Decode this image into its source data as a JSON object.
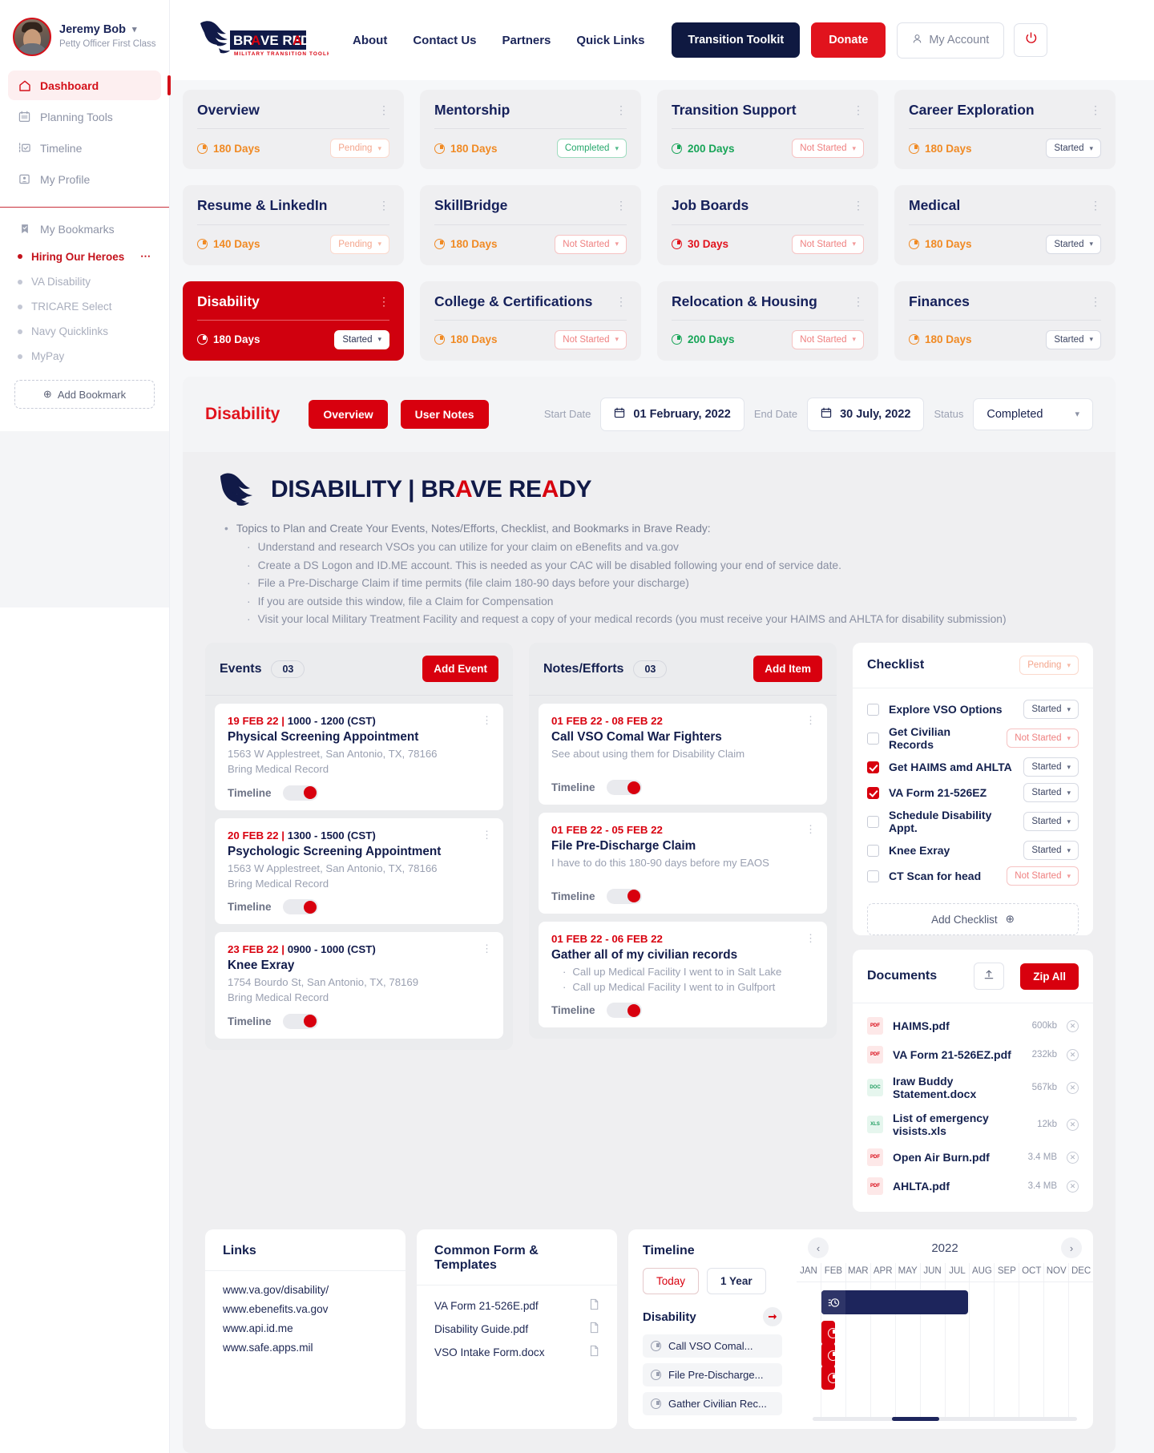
{
  "sidebar": {
    "profile": {
      "name": "Jeremy Bob",
      "rank": "Petty Officer First Class"
    },
    "nav": [
      {
        "label": "Dashboard",
        "icon": "home-icon",
        "active": true
      },
      {
        "label": "Planning Tools",
        "icon": "calendar-icon",
        "active": false
      },
      {
        "label": "Timeline",
        "icon": "timeline-icon",
        "active": false
      },
      {
        "label": "My Profile",
        "icon": "profile-icon",
        "active": false
      }
    ],
    "bookmarks_header": "My Bookmarks",
    "bookmarks": [
      {
        "label": "Hiring Our Heroes",
        "active": true
      },
      {
        "label": "VA Disability",
        "active": false
      },
      {
        "label": "TRICARE Select",
        "active": false
      },
      {
        "label": "Navy Quicklinks",
        "active": false
      },
      {
        "label": "MyPay",
        "active": false
      }
    ],
    "add_bookmark": "Add Bookmark"
  },
  "topbar": {
    "brand": {
      "line1": "BRAVE READY",
      "line2": "MILITARY TRANSITION TOOLKIT"
    },
    "links": [
      "About",
      "Contact Us",
      "Partners",
      "Quick Links"
    ],
    "transition_toolkit": "Transition Toolkit",
    "donate": "Donate",
    "my_account": "My Account",
    "logout_icon": "power-icon"
  },
  "cards": [
    {
      "title": "Overview",
      "days": "180 Days",
      "days_color": "orange",
      "status": "Pending",
      "status_style": "pending",
      "selected": false
    },
    {
      "title": "Mentorship",
      "days": "180 Days",
      "days_color": "orange",
      "status": "Completed",
      "status_style": "completed",
      "selected": false
    },
    {
      "title": "Transition Support",
      "days": "200 Days",
      "days_color": "green",
      "status": "Not Started",
      "status_style": "notstarted",
      "selected": false
    },
    {
      "title": "Career Exploration",
      "days": "180 Days",
      "days_color": "orange",
      "status": "Started",
      "status_style": "started",
      "selected": false
    },
    {
      "title": "Resume & LinkedIn",
      "days": "140 Days",
      "days_color": "orange",
      "status": "Pending",
      "status_style": "pending",
      "selected": false
    },
    {
      "title": "SkillBridge",
      "days": "180 Days",
      "days_color": "orange",
      "status": "Not Started",
      "status_style": "notstarted",
      "selected": false
    },
    {
      "title": "Job Boards",
      "days": "30 Days",
      "days_color": "red",
      "status": "Not Started",
      "status_style": "notstarted",
      "selected": false
    },
    {
      "title": "Medical",
      "days": "180 Days",
      "days_color": "orange",
      "status": "Started",
      "status_style": "started",
      "selected": false
    },
    {
      "title": "Disability",
      "days": "180 Days",
      "days_color": "orange",
      "status": "Started",
      "status_style": "started",
      "selected": true
    },
    {
      "title": "College & Certifications",
      "days": "180 Days",
      "days_color": "orange",
      "status": "Not Started",
      "status_style": "notstarted",
      "selected": false
    },
    {
      "title": "Relocation & Housing",
      "days": "200 Days",
      "days_color": "green",
      "status": "Not Started",
      "status_style": "notstarted",
      "selected": false
    },
    {
      "title": "Finances",
      "days": "180 Days",
      "days_color": "orange",
      "status": "Started",
      "status_style": "started",
      "selected": false
    }
  ],
  "detail": {
    "title": "Disability",
    "tab_overview": "Overview",
    "tab_user_notes": "User Notes",
    "start_date_label": "Start Date",
    "start_date": "01 February, 2022",
    "end_date_label": "End Date",
    "end_date": "30 July, 2022",
    "status_label": "Status",
    "status_value": "Completed",
    "hero_left": "DISABILITY | BR",
    "hero_a1": "A",
    "hero_mid": "VE RE",
    "hero_a2": "A",
    "hero_end": "DY",
    "intro": "Topics to Plan and Create Your Events, Notes/Efforts, Checklist, and Bookmarks in Brave Ready:",
    "points": [
      "Understand and research VSOs you can utilize for your claim on eBenefits and va.gov",
      "Create a DS Logon and ID.ME account.  This is needed as your CAC will be disabled following your end of service date.",
      "File a Pre-Discharge Claim if time permits (file claim 180-90 days before your discharge)",
      "If you are outside this window, file a Claim for Compensation",
      "Visit your local Military Treatment Facility and request a copy of your medical records (you must receive your HAIMS and AHLTA for disability submission)"
    ]
  },
  "events": {
    "title": "Events",
    "count": "03",
    "add_label": "Add Event",
    "timeline_label": "Timeline",
    "items": [
      {
        "date": "19 FEB 22",
        "time": "1000 - 1200 (CST)",
        "title": "Physical Screening Appointment",
        "line1": "1563 W Applestreet, San Antonio, TX, 78166",
        "line2": "Bring Medical Record"
      },
      {
        "date": "20 FEB 22",
        "time": "1300 - 1500 (CST)",
        "title": "Psychologic Screening Appointment",
        "line1": "1563 W Applestreet, San Antonio, TX, 78166",
        "line2": "Bring Medical Record"
      },
      {
        "date": "23 FEB 22",
        "time": "0900 - 1000 (CST)",
        "title": "Knee Exray",
        "line1": "1754 Bourdo St, San Antonio, TX, 78169",
        "line2": "Bring Medical Record"
      }
    ]
  },
  "notes": {
    "title": "Notes/Efforts",
    "count": "03",
    "add_label": "Add Item",
    "timeline_label": "Timeline",
    "items": [
      {
        "date": "01 FEB 22 - 08 FEB 22",
        "title": "Call VSO Comal War Fighters",
        "sub": "See about using them for Disability Claim",
        "bullets": []
      },
      {
        "date": "01 FEB 22 - 05 FEB 22",
        "title": "File Pre-Discharge Claim",
        "sub": "I have to do this 180-90 days before my EAOS",
        "bullets": []
      },
      {
        "date": "01 FEB 22 - 06 FEB 22",
        "title": "Gather all of my civilian records",
        "sub": "",
        "bullets": [
          "Call up Medical Facility I went to in Salt Lake",
          "Call up Medical Facility I went to in Gulfport"
        ]
      }
    ]
  },
  "checklist": {
    "title": "Checklist",
    "status": "Pending",
    "add_label": "Add Checklist",
    "items": [
      {
        "label": "Explore VSO Options",
        "checked": false,
        "status": "Started",
        "style": "started"
      },
      {
        "label": "Get Civilian Records",
        "checked": false,
        "status": "Not Started",
        "style": "notstarted"
      },
      {
        "label": "Get HAIMS amd AHLTA",
        "checked": true,
        "status": "Started",
        "style": "started"
      },
      {
        "label": "VA Form 21-526EZ",
        "checked": true,
        "status": "Started",
        "style": "started"
      },
      {
        "label": "Schedule Disability Appt.",
        "checked": false,
        "status": "Started",
        "style": "started"
      },
      {
        "label": "Knee Exray",
        "checked": false,
        "status": "Started",
        "style": "started"
      },
      {
        "label": "CT Scan for head",
        "checked": false,
        "status": "Not Started",
        "style": "notstarted"
      }
    ]
  },
  "documents": {
    "title": "Documents",
    "zip_label": "Zip All",
    "upload_icon": "upload-icon",
    "items": [
      {
        "name": "HAIMS.pdf",
        "size": "600kb",
        "kind": "pdf"
      },
      {
        "name": "VA Form 21-526EZ.pdf",
        "size": "232kb",
        "kind": "pdf"
      },
      {
        "name": "Iraw Buddy Statement.docx",
        "size": "567kb",
        "kind": "doc"
      },
      {
        "name": "List of emergency visists.xls",
        "size": "12kb",
        "kind": "xls"
      },
      {
        "name": "Open Air Burn.pdf",
        "size": "3.4 MB",
        "kind": "pdf"
      },
      {
        "name": "AHLTA.pdf",
        "size": "3.4 MB",
        "kind": "pdf"
      }
    ]
  },
  "links": {
    "title": "Links",
    "items": [
      "www.va.gov/disability/",
      "www.ebenefits.va.gov",
      "www.api.id.me",
      "www.safe.apps.mil"
    ]
  },
  "forms": {
    "title": "Common Form & Templates",
    "items": [
      "VA Form 21-526E.pdf",
      "Disability Guide.pdf",
      "VSO Intake Form.docx"
    ]
  },
  "timeline": {
    "title": "Timeline",
    "today": "Today",
    "range": "1 Year",
    "group": "Disability",
    "tasks": [
      "Call VSO Comal...",
      "File Pre-Discharge...",
      "Gather Civilian Rec..."
    ],
    "year": "2022",
    "months": [
      "JAN",
      "FEB",
      "MAR",
      "APR",
      "MAY",
      "JUN",
      "JUL",
      "AUG",
      "SEP",
      "OCT",
      "NOV",
      "DEC"
    ],
    "bars": [
      {
        "start_month": 1,
        "span": 6,
        "color": "dark",
        "icon": "schedule-icon"
      },
      {
        "start_month": 1,
        "span": 0.55,
        "color": "red",
        "icon": "clock-icon"
      },
      {
        "start_month": 1,
        "span": 0.55,
        "color": "red",
        "icon": "clock-icon"
      },
      {
        "start_month": 1,
        "span": 0.55,
        "color": "red",
        "icon": "clock-icon"
      }
    ]
  }
}
